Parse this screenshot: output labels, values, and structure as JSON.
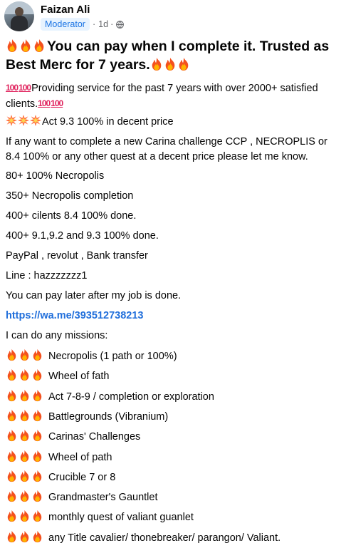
{
  "author": {
    "name": "Faizan Ali",
    "badge": "Moderator",
    "time": "1d",
    "separator": "·"
  },
  "post": {
    "title": "You can pay when I complete it. Trusted as Best Merc for 7 years.",
    "intro": "Providing service for the past 7 years with over 2000+ satisfied clients.",
    "act_line": "Act 9.3 100% in decent price",
    "offer": "If any want to complete a new Carina challenge CCP , NECROPLIS or 8.4 100% or any other quest at a decent price please let me know.",
    "stats": [
      "80+ 100% Necropolis",
      "350+ Necropolis completion",
      "400+ cilents 8.4 100% done.",
      "400+ 9.1,9.2 and 9.3 100% done."
    ],
    "payment": "PayPal , revolut , Bank transfer",
    "line_id": "Line : hazzzzzzz1",
    "pay_later": "You can pay later after my job is done.",
    "link": "https://wa.me/393512738213",
    "missions_heading": "I can do any missions:",
    "missions": [
      "Necropolis (1 path or 100%)",
      "Wheel of fath",
      "Act 7-8-9 / completion or exploration",
      "Battlegrounds (Vibranium)",
      "Carinas' Challenges",
      "Wheel of path",
      "Crucible 7 or 8",
      "Grandmaster's Gauntlet",
      "monthly quest of valiant guanlet",
      "any Title cavalier/ thonebreaker/ parangon/ Valiant."
    ]
  },
  "icons": {
    "fire": "fire-emoji-icon",
    "hundred": "hundred-points-emoji-icon",
    "collision": "collision-emoji-icon",
    "globe": "globe-icon"
  },
  "colors": {
    "link": "#216fdb",
    "badge_bg": "#e7f3ff",
    "badge_text": "#1b74e4",
    "meta": "#65676b"
  }
}
